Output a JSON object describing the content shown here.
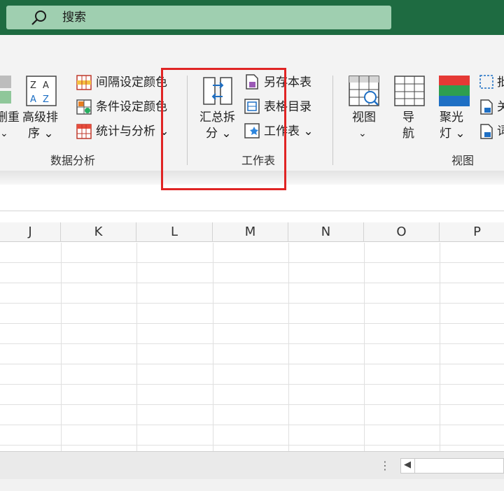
{
  "search": {
    "label": "搜索"
  },
  "ribbon": {
    "partial_left": {
      "line1": "删重",
      "chev": "⌄"
    },
    "sort": {
      "line1": "高级排",
      "line2": "序 ⌄"
    },
    "data_items": [
      {
        "label": "间隔设定颜色"
      },
      {
        "label": "条件设定颜色"
      },
      {
        "label": "统计与分析 ⌄"
      }
    ],
    "data_group": "数据分析",
    "sheet_split": {
      "line1": "汇总拆",
      "line2": "分 ⌄"
    },
    "sheet_items": [
      {
        "label": "另存本表"
      },
      {
        "label": "表格目录"
      },
      {
        "label": "工作表  ⌄"
      }
    ],
    "sheet_group": "工作表",
    "view": {
      "line1": "视图",
      "line2": "⌄"
    },
    "nav": {
      "line1": "导",
      "line2": "航"
    },
    "spotlight": {
      "line1": "聚光",
      "line2": "灯 ⌄"
    },
    "view_group": "视图",
    "partial_right": [
      "批",
      "关",
      "词"
    ]
  },
  "columns": [
    "J",
    "K",
    "L",
    "M",
    "N",
    "O",
    "P"
  ],
  "status": {
    "dots": "⋮",
    "scroll_arrow": "◀"
  }
}
